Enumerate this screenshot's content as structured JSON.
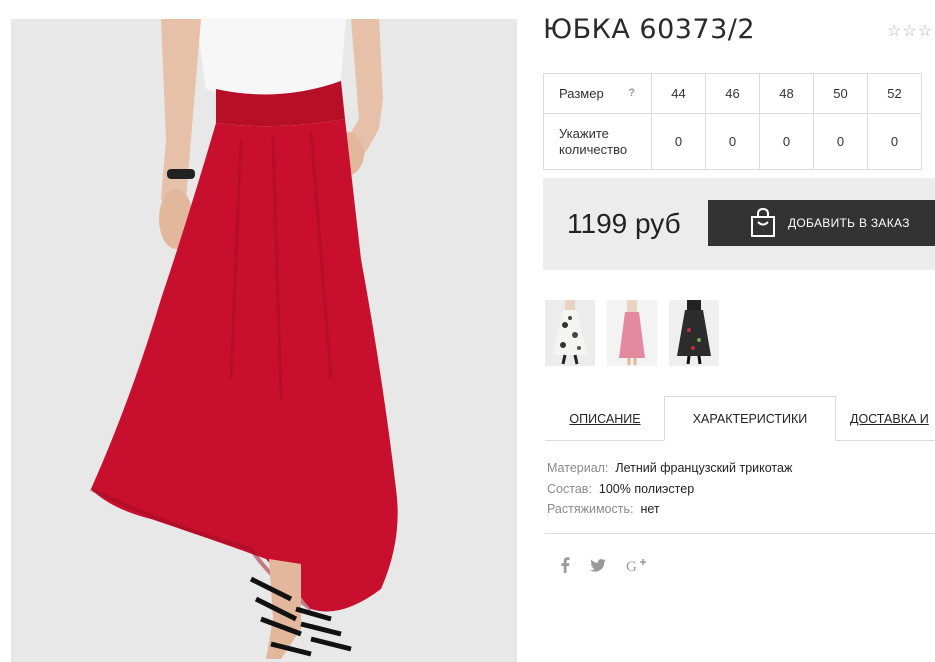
{
  "product": {
    "title": "ЮБКА 60373/2",
    "rating_stars": 5,
    "rating_filled": 0
  },
  "size_table": {
    "size_label": "Размер",
    "help_symbol": "?",
    "qty_label": "Укажите количество",
    "sizes": [
      "44",
      "46",
      "48",
      "50",
      "52"
    ],
    "quantities": [
      "0",
      "0",
      "0",
      "0",
      "0"
    ]
  },
  "buy": {
    "price": "1199 руб",
    "add_to_order": "ДОБАВИТЬ В ЗАКАЗ",
    "icon": "shopping-bag-icon"
  },
  "thumbnails": [
    {
      "name": "floral-print-skirt"
    },
    {
      "name": "pink-skirt"
    },
    {
      "name": "dark-floral-skirt"
    }
  ],
  "tabs": [
    {
      "label": "ОПИСАНИЕ",
      "active": false
    },
    {
      "label": "ХАРАКТЕРИСТИКИ",
      "active": true
    },
    {
      "label": "ДОСТАВКА И",
      "active": false
    }
  ],
  "characteristics": [
    {
      "key": "Материал:",
      "value": "Летний французский трикотаж"
    },
    {
      "key": "Состав:",
      "value": "100% полиэстер"
    },
    {
      "key": "Растяжимость:",
      "value": "нет"
    }
  ],
  "social": [
    "facebook-icon",
    "twitter-icon",
    "google-plus-icon"
  ],
  "colors": {
    "accent_dark": "#333333",
    "skirt_red": "#c8102e",
    "panel_bg": "#ececec"
  }
}
